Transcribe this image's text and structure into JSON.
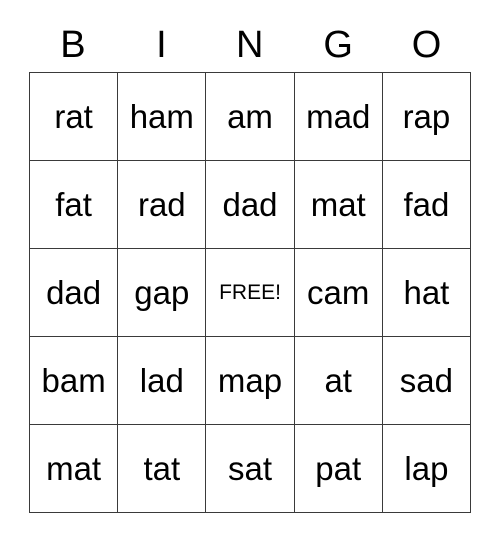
{
  "card": {
    "title": "BINGO",
    "headers": [
      "B",
      "I",
      "N",
      "G",
      "O"
    ],
    "free_space_label": "FREE!",
    "free_space_position": {
      "row": 2,
      "col": 2
    },
    "rows": [
      [
        "rat",
        "ham",
        "am",
        "mad",
        "rap"
      ],
      [
        "fat",
        "rad",
        "dad",
        "mat",
        "fad"
      ],
      [
        "dad",
        "gap",
        "FREE!",
        "cam",
        "hat"
      ],
      [
        "bam",
        "lad",
        "map",
        "at",
        "sad"
      ],
      [
        "mat",
        "tat",
        "sat",
        "pat",
        "lap"
      ]
    ]
  },
  "style": {
    "border_color": "#3a3a3a",
    "text_color": "#000000",
    "background_color": "#ffffff"
  }
}
